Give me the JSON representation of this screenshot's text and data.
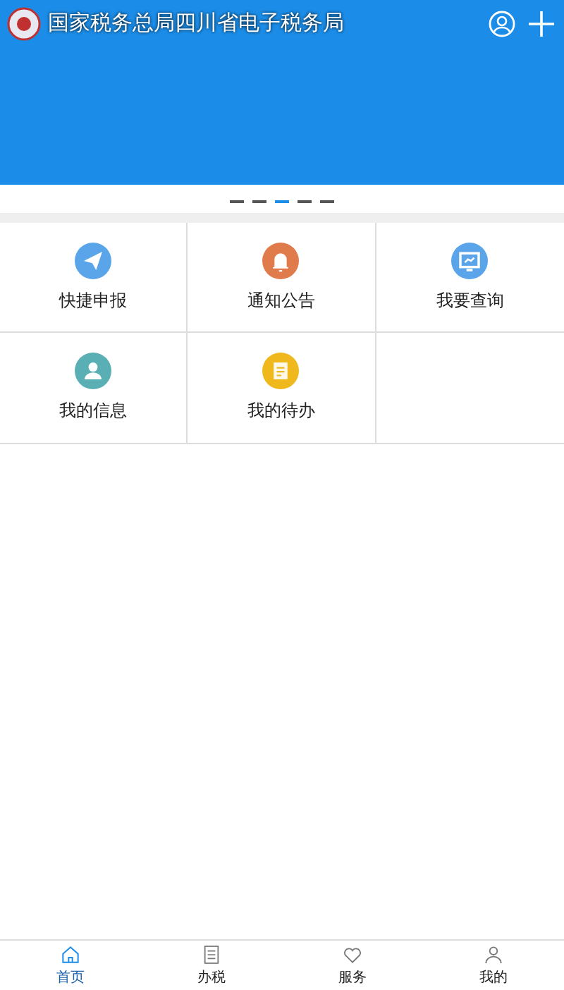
{
  "header": {
    "title": "国家税务总局四川省电子税务局"
  },
  "carousel": {
    "dots": [
      {
        "selected": false
      },
      {
        "selected": false
      },
      {
        "selected": true
      },
      {
        "selected": false
      },
      {
        "selected": false
      }
    ]
  },
  "menu": [
    {
      "label": "快捷申报",
      "kind": "send",
      "color": "#5aa5ea"
    },
    {
      "label": "通知公告",
      "kind": "bell",
      "color": "#e07b4c"
    },
    {
      "label": "我要查询",
      "kind": "monitor",
      "color": "#5aa5ea"
    },
    {
      "label": "我的信息",
      "kind": "person",
      "color": "#5aafb5"
    },
    {
      "label": "我的待办",
      "kind": "note",
      "color": "#efb81c"
    }
  ],
  "tabbar": [
    {
      "label": "首页",
      "kind": "home",
      "selected": true
    },
    {
      "label": "办税",
      "kind": "list",
      "selected": false
    },
    {
      "label": "服务",
      "kind": "heart",
      "selected": false
    },
    {
      "label": "我的",
      "kind": "person",
      "selected": false
    }
  ]
}
